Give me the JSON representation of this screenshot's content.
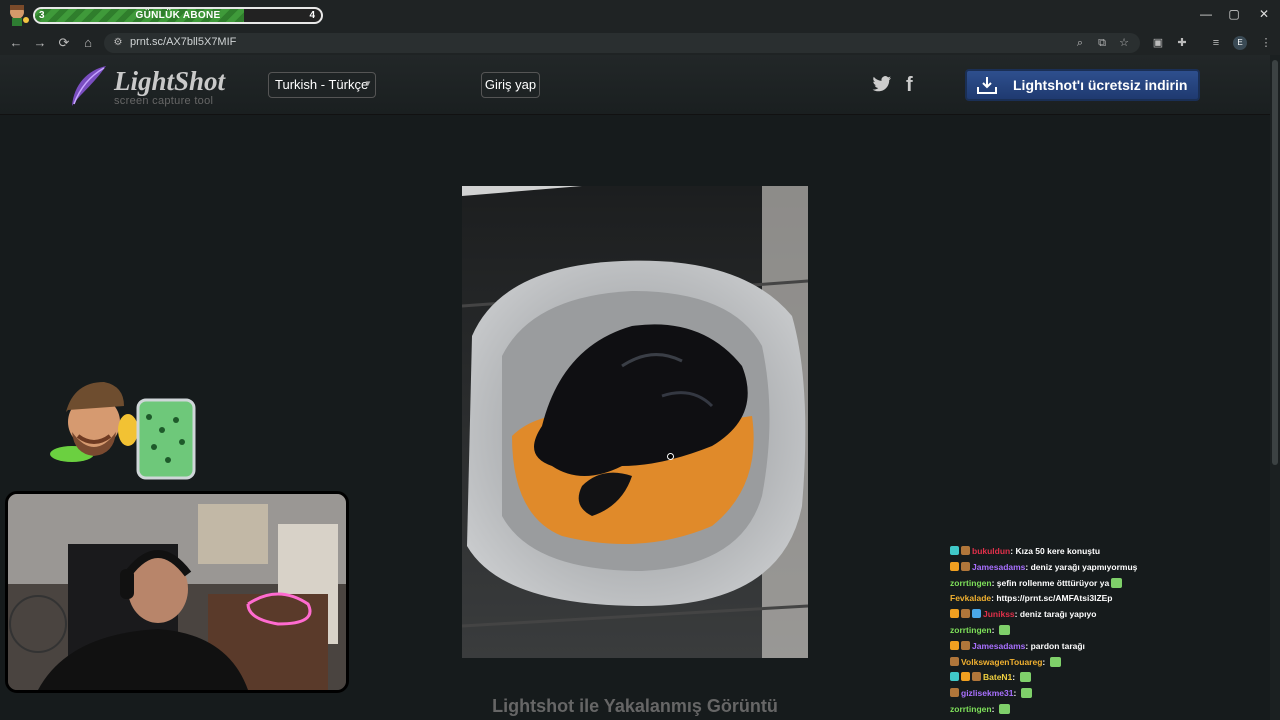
{
  "sub_goal": {
    "current": "3",
    "label": "GÜNLÜK ABONE",
    "goal": "4",
    "progress_fraction": 0.73
  },
  "window": {
    "minimize": "—",
    "maximize": "▢",
    "close": "✕"
  },
  "browser": {
    "url": "prnt.sc/AX7bll5X7MIF"
  },
  "site": {
    "logo_name": "LightShot",
    "logo_tagline": "screen capture tool",
    "language": "Turkish - Türkçe",
    "login_label": "Giriş yap",
    "download_label": "Lightshot'ı ücretsiz indirin",
    "caption": "Lightshot ile Yakalanmış Görüntü"
  },
  "colors": {
    "accent_blue": "#2e4f8e",
    "page_bg": "#161b1c",
    "goal_green": "#3f9a3a"
  },
  "chat": [
    {
      "user": "bukuldun",
      "color": "#e0304a",
      "text": "Kıza 50 kere konuştu",
      "badges": [
        "#40c8c8",
        "#b0763a"
      ],
      "emote": false
    },
    {
      "user": "Jamesadams",
      "color": "#a970ff",
      "text": "deniz yarağı yapmıyormuş",
      "badges": [
        "#f0a020",
        "#b0763a"
      ],
      "emote": false
    },
    {
      "user": "zorrtingen",
      "color": "#7ee05a",
      "text": "şefin rollenme ötttürüyor ya",
      "badges": [],
      "emote": true
    },
    {
      "user": "Fevkalade",
      "color": "#f0b030",
      "text": "https://prnt.sc/AMFAtsi3lZEp",
      "badges": [],
      "emote": false
    },
    {
      "user": "Junikss",
      "color": "#e0304a",
      "text": "deniz tarağı yapıyo",
      "badges": [
        "#f0a020",
        "#b0763a",
        "#4aa8e8"
      ],
      "emote": false
    },
    {
      "user": "zorrtingen",
      "color": "#7ee05a",
      "text": "",
      "badges": [],
      "emote": true
    },
    {
      "user": "Jamesadams",
      "color": "#a970ff",
      "text": "pardon tarağı",
      "badges": [
        "#f0a020",
        "#b0763a"
      ],
      "emote": false
    },
    {
      "user": "VolkswagenTouareg",
      "color": "#f0b030",
      "text": "",
      "badges": [
        "#b0763a"
      ],
      "emote": true
    },
    {
      "user": "BateN1",
      "color": "#f0d040",
      "text": "",
      "badges": [
        "#40c8c8",
        "#f0a020",
        "#b0763a"
      ],
      "emote": true
    },
    {
      "user": "gizlisekme31",
      "color": "#a970ff",
      "text": "",
      "badges": [
        "#b0763a"
      ],
      "emote": true
    },
    {
      "user": "zorrtingen",
      "color": "#7ee05a",
      "text": "",
      "badges": [],
      "emote": true
    }
  ]
}
